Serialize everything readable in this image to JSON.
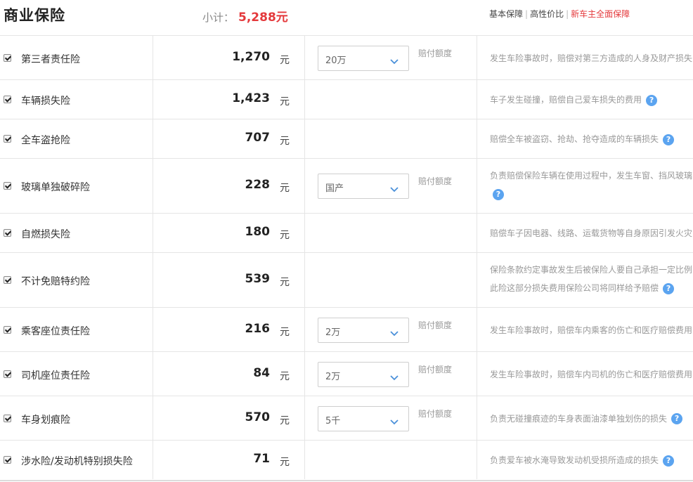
{
  "header": {
    "title": "商业保险",
    "subtotal_label": "小计：",
    "subtotal_value": "5,288元",
    "plans": [
      {
        "label": "基本保障",
        "active": false
      },
      {
        "label": "高性价比",
        "active": false
      },
      {
        "label": "新车主全面保障",
        "active": true
      }
    ],
    "separator": "|"
  },
  "common": {
    "unit": "元",
    "amount_label": "赔付额度",
    "help_glyph": "?"
  },
  "rows": [
    {
      "name": "第三者责任险",
      "price": "1,270",
      "select": "20万",
      "desc": [
        "发生车险事故时，赔偿对第三方造成的人身及财产损失"
      ],
      "help": false
    },
    {
      "name": "车辆损失险",
      "price": "1,423",
      "select": null,
      "desc": [
        "车子发生碰撞，赔偿自己爱车损失的费用"
      ],
      "help": true
    },
    {
      "name": "全车盗抢险",
      "price": "707",
      "select": null,
      "desc": [
        "赔偿全车被盗窃、抢劫、抢夺造成的车辆损失"
      ],
      "help": true
    },
    {
      "name": "玻璃单独破碎险",
      "price": "228",
      "select": "国产",
      "desc": [
        "负责赔偿保险车辆在使用过程中，发生车窗、挡风玻璃",
        ""
      ],
      "help": true
    },
    {
      "name": "自燃损失险",
      "price": "180",
      "select": null,
      "desc": [
        "赔偿车子因电器、线路、运载货物等自身原因引发火灾"
      ],
      "help": false
    },
    {
      "name": "不计免赔特约险",
      "price": "539",
      "select": null,
      "desc": [
        "保险条款约定事故发生后被保险人要自己承担一定比例",
        "此险这部分损失费用保险公司将同样给予赔偿"
      ],
      "help": true
    },
    {
      "name": "乘客座位责任险",
      "price": "216",
      "select": "2万",
      "desc": [
        "发生车险事故时，赔偿车内乘客的伤亡和医疗赔偿费用"
      ],
      "help": false
    },
    {
      "name": "司机座位责任险",
      "price": "84",
      "select": "2万",
      "desc": [
        "发生车险事故时，赔偿车内司机的伤亡和医疗赔偿费用"
      ],
      "help": false
    },
    {
      "name": "车身划痕险",
      "price": "570",
      "select": "5千",
      "desc": [
        "负责无碰撞痕迹的车身表面油漆单独划伤的损失"
      ],
      "help": true
    },
    {
      "name": "涉水险/发动机特别损失险",
      "price": "71",
      "select": null,
      "desc": [
        "负责爱车被水淹导致发动机受损所造成的损失"
      ],
      "help": true
    }
  ]
}
